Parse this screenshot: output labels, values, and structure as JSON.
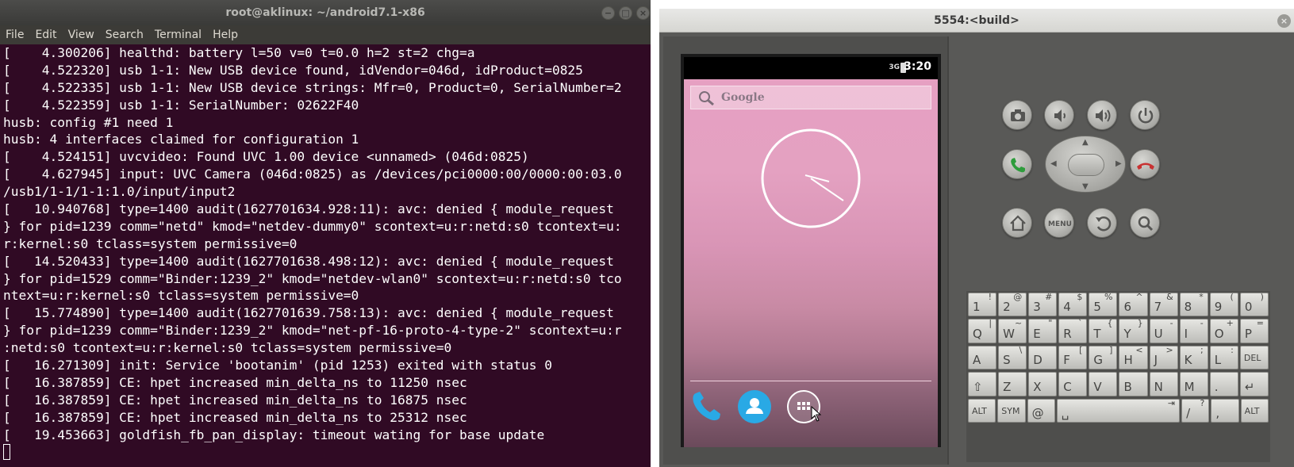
{
  "terminal": {
    "title": "root@aklinux: ~/android7.1-x86",
    "window_buttons": [
      "−",
      "□",
      "×"
    ],
    "menu": [
      "File",
      "Edit",
      "View",
      "Search",
      "Terminal",
      "Help"
    ],
    "lines": [
      "[    4.300206] healthd: battery l=50 v=0 t=0.0 h=2 st=2 chg=a",
      "[    4.522320] usb 1-1: New USB device found, idVendor=046d, idProduct=0825",
      "[    4.522335] usb 1-1: New USB device strings: Mfr=0, Product=0, SerialNumber=2",
      "[    4.522359] usb 1-1: SerialNumber: 02622F40",
      "husb: config #1 need 1",
      "husb: 4 interfaces claimed for configuration 1",
      "[    4.524151] uvcvideo: Found UVC 1.00 device <unnamed> (046d:0825)",
      "[    4.627945] input: UVC Camera (046d:0825) as /devices/pci0000:00/0000:00:03.0",
      "/usb1/1-1/1-1:1.0/input/input2",
      "[   10.940768] type=1400 audit(1627701634.928:11): avc: denied { module_request",
      "} for pid=1239 comm=\"netd\" kmod=\"netdev-dummy0\" scontext=u:r:netd:s0 tcontext=u:",
      "r:kernel:s0 tclass=system permissive=0",
      "[   14.520433] type=1400 audit(1627701638.498:12): avc: denied { module_request",
      "} for pid=1529 comm=\"Binder:1239_2\" kmod=\"netdev-wlan0\" scontext=u:r:netd:s0 tco",
      "ntext=u:r:kernel:s0 tclass=system permissive=0",
      "[   15.774890] type=1400 audit(1627701639.758:13): avc: denied { module_request",
      "} for pid=1239 comm=\"Binder:1239_2\" kmod=\"net-pf-16-proto-4-type-2\" scontext=u:r",
      ":netd:s0 tcontext=u:r:kernel:s0 tclass=system permissive=0",
      "[   16.271309] init: Service 'bootanim' (pid 1253) exited with status 0",
      "[   16.387859] CE: hpet increased min_delta_ns to 11250 nsec",
      "[   16.387859] CE: hpet increased min_delta_ns to 16875 nsec",
      "[   16.387859] CE: hpet increased min_delta_ns to 25312 nsec",
      "[   19.453663] goldfish_fb_pan_display: timeout wating for base update"
    ]
  },
  "emulator": {
    "title": "5554:<build>",
    "close_button": "×",
    "status_time": "3:20",
    "network_badge": "3G",
    "search_label": "Google",
    "keyboard": {
      "rows": [
        [
          [
            "1",
            "!"
          ],
          [
            "2",
            "@"
          ],
          [
            "3",
            "#"
          ],
          [
            "4",
            "$"
          ],
          [
            "5",
            "%"
          ],
          [
            "6",
            "^"
          ],
          [
            "7",
            "&"
          ],
          [
            "8",
            "*"
          ],
          [
            "9",
            "("
          ],
          [
            "0",
            ")"
          ]
        ],
        [
          [
            "Q",
            "|"
          ],
          [
            "W",
            "~"
          ],
          [
            "E",
            "\""
          ],
          [
            "R",
            "`"
          ],
          [
            "T",
            "{"
          ],
          [
            "Y",
            "}"
          ],
          [
            "U",
            "-"
          ],
          [
            "I",
            "-"
          ],
          [
            "O",
            "+"
          ],
          [
            "P",
            "="
          ]
        ],
        [
          [
            "A",
            ""
          ],
          [
            "S",
            "\\"
          ],
          [
            "D",
            ""
          ],
          [
            "F",
            "["
          ],
          [
            "G",
            "]"
          ],
          [
            "H",
            "<"
          ],
          [
            "J",
            ">"
          ],
          [
            "K",
            ";"
          ],
          [
            "L",
            ":"
          ],
          [
            "DEL",
            ""
          ]
        ],
        [
          [
            "⇧",
            ""
          ],
          [
            "Z",
            ""
          ],
          [
            "X",
            ""
          ],
          [
            "C",
            ""
          ],
          [
            "V",
            ""
          ],
          [
            "B",
            ""
          ],
          [
            "N",
            ""
          ],
          [
            "M",
            ""
          ],
          [
            ".",
            ""
          ],
          [
            "↵",
            ""
          ]
        ],
        [
          [
            "ALT",
            ""
          ],
          [
            "SYM",
            ""
          ],
          [
            "@",
            ""
          ],
          [
            "␣",
            "⇥"
          ],
          [
            "/",
            "?"
          ],
          [
            ",",
            ""
          ],
          [
            "ALT",
            ""
          ]
        ]
      ]
    }
  }
}
